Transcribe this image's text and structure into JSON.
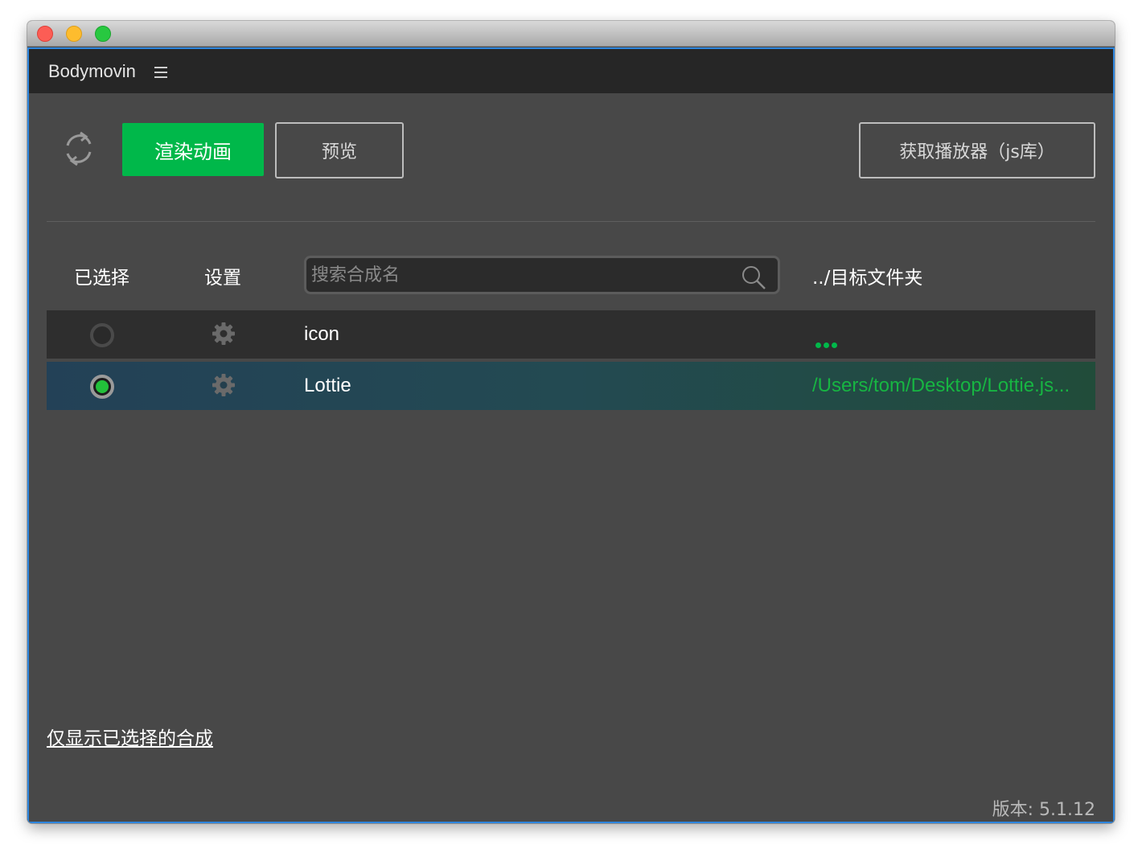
{
  "window": {
    "controls": [
      "close",
      "minimize",
      "zoom"
    ]
  },
  "header": {
    "title": "Bodymovin",
    "menu_icon": "hamburger-icon"
  },
  "toolbar": {
    "refresh_icon": "refresh-icon",
    "render_label": "渲染动画",
    "preview_label": "预览",
    "player_label": "获取播放器（js库）"
  },
  "columns": {
    "selected": "已选择",
    "settings": "设置",
    "destination": "../目标文件夹"
  },
  "search": {
    "placeholder": "搜索合成名",
    "value": ""
  },
  "compositions": [
    {
      "name": "icon",
      "selected": false,
      "destination": "..."
    },
    {
      "name": "Lottie",
      "selected": true,
      "destination": "/Users/tom/Desktop/Lottie.js..."
    }
  ],
  "footer": {
    "show_selected_label": "仅显示已选择的合成",
    "version": "版本: 5.1.12"
  },
  "colors": {
    "accent_green": "#00b84a",
    "path_green": "#17b542",
    "panel_bg": "#484848",
    "header_bg": "#262626",
    "selection_border": "#2e86de"
  }
}
